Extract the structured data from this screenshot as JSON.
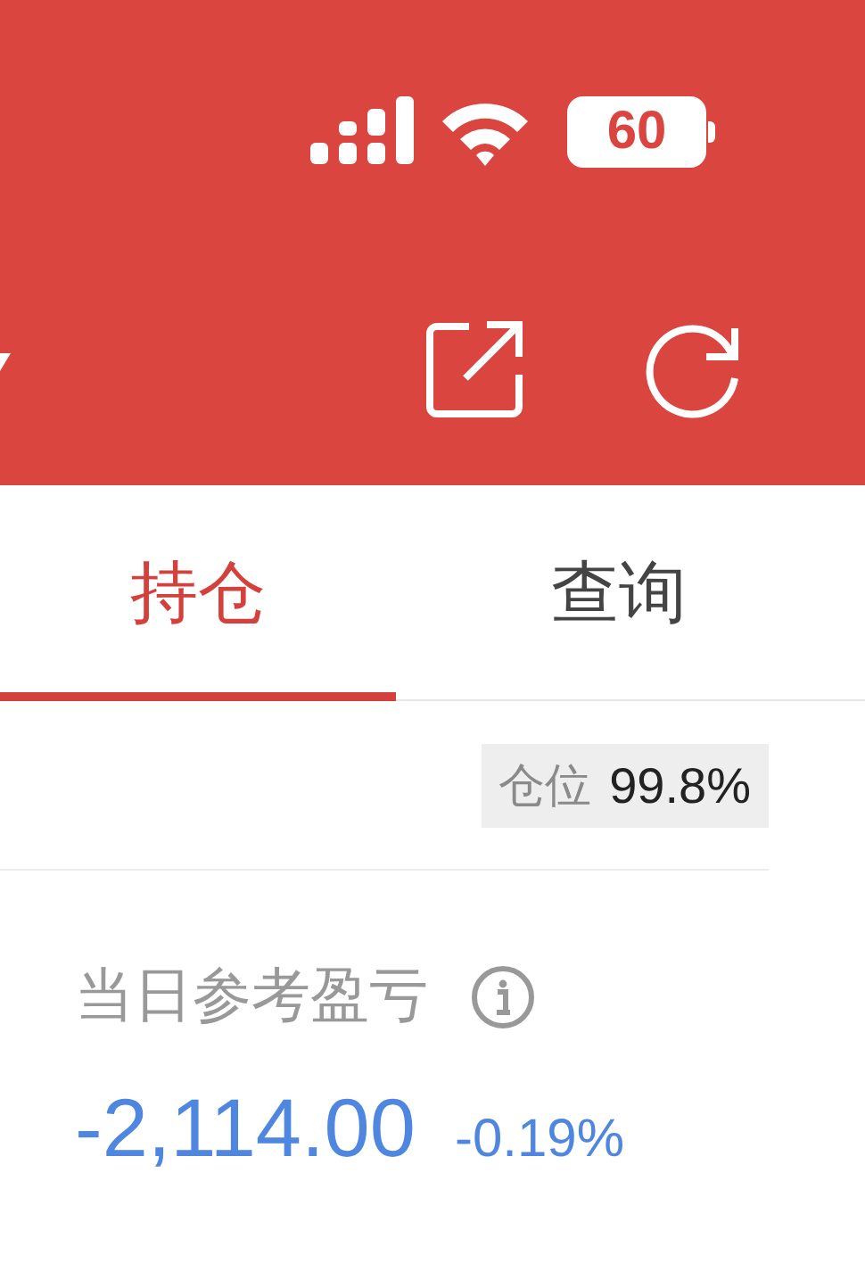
{
  "status_bar": {
    "battery": "60"
  },
  "tabs": [
    {
      "label": "持仓",
      "selected": true
    },
    {
      "label": "查询",
      "selected": false
    }
  ],
  "position": {
    "label": "仓位",
    "value": "99.8%"
  },
  "pnl": {
    "label": "当日参考盈亏",
    "value": "-2,114.00",
    "percent": "-0.19%"
  }
}
